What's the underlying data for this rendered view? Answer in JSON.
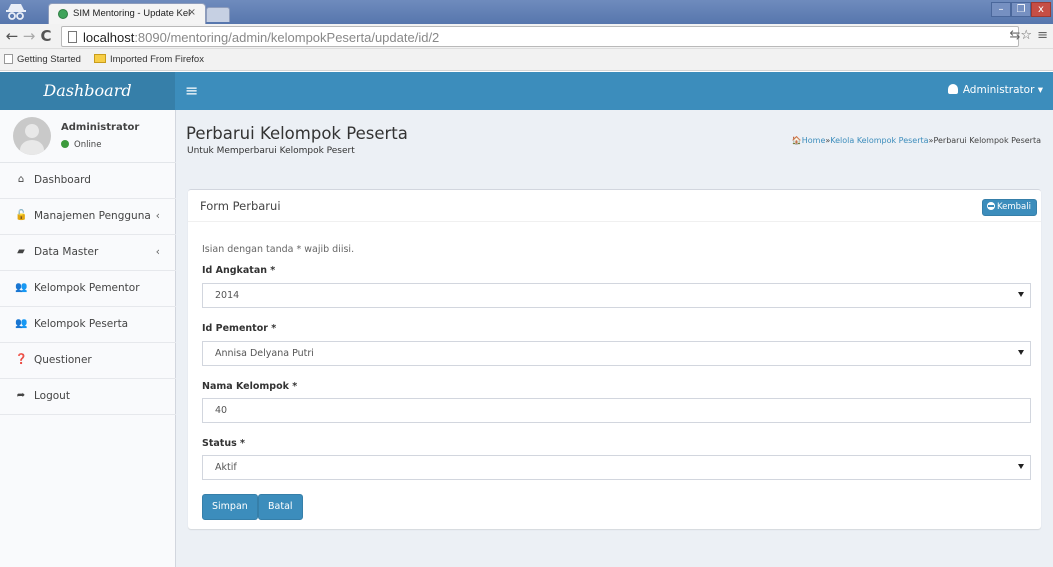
{
  "browser": {
    "tab_title": "SIM Mentoring - Update Kelo",
    "tab_close": "×",
    "url_host": "localhost",
    "url_rest": ":8090/mentoring/admin/kelompokPeserta/update/id/2",
    "window_controls": {
      "minimize": "–",
      "maximize": "❐",
      "close": "x"
    },
    "nav": {
      "back": "←",
      "forward": "→",
      "reload": "C"
    },
    "toolbar_icons": {
      "translate": "⇆☆",
      "menu": "≡"
    },
    "bookmarks": [
      "Getting Started",
      "Imported From Firefox"
    ]
  },
  "app": {
    "brand": "Dashboard",
    "hamburger": "≡",
    "user_menu": "Administrator ▾",
    "user_panel": {
      "name": "Administrator",
      "status": "Online"
    },
    "sidebar": [
      {
        "icon": "home-icon",
        "glyph": "⌂",
        "label": "Dashboard",
        "chevron": ""
      },
      {
        "icon": "unlock-icon",
        "glyph": "🔓",
        "label": "Manajemen Pengguna",
        "chevron": "‹"
      },
      {
        "icon": "book-icon",
        "glyph": "▰",
        "label": "Data Master",
        "chevron": "‹"
      },
      {
        "icon": "users-icon",
        "glyph": "👥",
        "label": "Kelompok Pementor",
        "chevron": ""
      },
      {
        "icon": "users-icon",
        "glyph": "👥",
        "label": "Kelompok Peserta",
        "chevron": ""
      },
      {
        "icon": "question-circle-icon",
        "glyph": "❓",
        "label": "Questioner",
        "chevron": ""
      },
      {
        "icon": "sign-out-icon",
        "glyph": "➦",
        "label": "Logout",
        "chevron": ""
      }
    ],
    "page": {
      "title": "Perbarui Kelompok Peserta",
      "subtitle": "Untuk Memperbarui Kelompok Pesert",
      "breadcrumb": {
        "home": "Home",
        "sep": "»",
        "parent": "Kelola Kelompok Peserta",
        "current": "Perbarui Kelompok Peserta"
      }
    },
    "form": {
      "box_title": "Form Perbarui",
      "back_button": "Kembali",
      "note": "Isian dengan tanda * wajib diisi.",
      "fields": [
        {
          "label": "Id Angkatan *",
          "value": "2014",
          "type": "select"
        },
        {
          "label": "Id Pementor *",
          "value": "Annisa Delyana Putri",
          "type": "select"
        },
        {
          "label": "Nama Kelompok *",
          "value": "40",
          "type": "text"
        },
        {
          "label": "Status *",
          "value": "Aktif",
          "type": "select"
        }
      ],
      "save_button": "Simpan",
      "cancel_button": "Batal"
    },
    "colors": {
      "navbar": "#3c8dbc",
      "brand_bg": "#367fa9",
      "content_bg": "#ecf0f5",
      "sidebar_bg": "#f9fafc",
      "online": "#3c9a3c"
    }
  }
}
